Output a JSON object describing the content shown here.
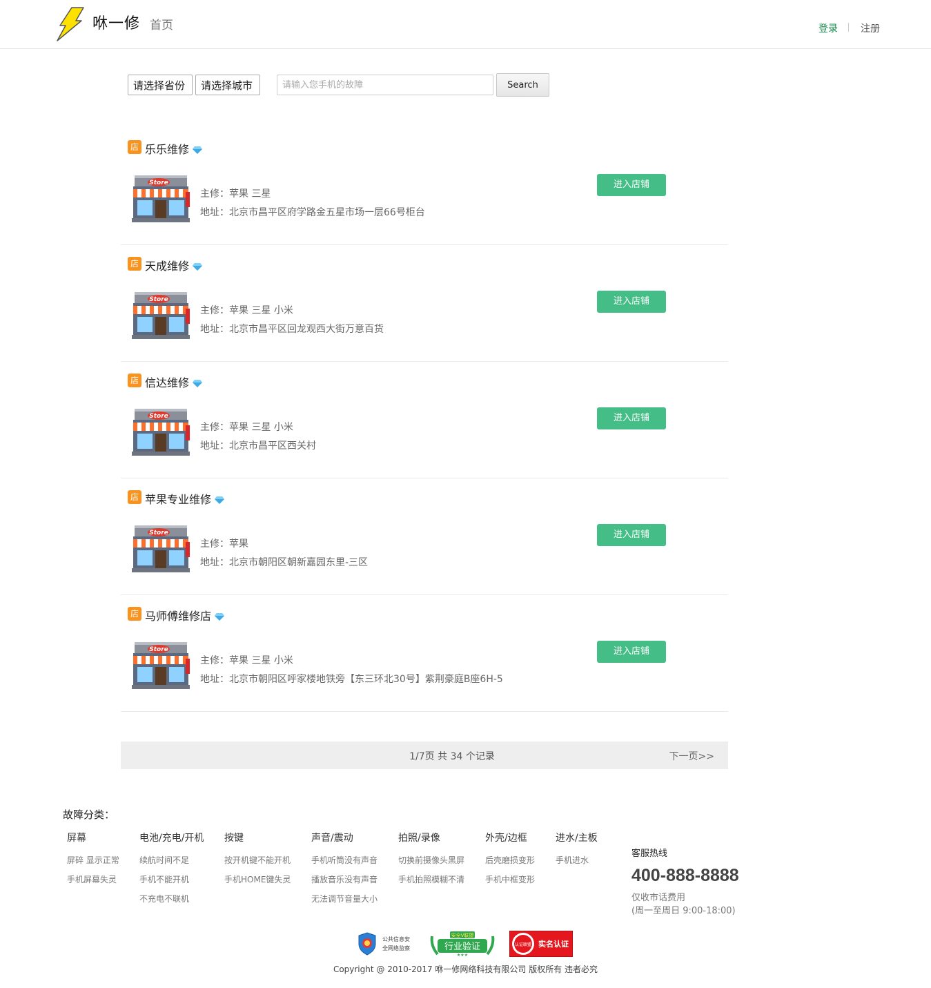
{
  "header": {
    "brand": "咻一修",
    "home": "首页",
    "login": "登录",
    "register": "注册"
  },
  "search": {
    "province": "请选择省份",
    "city": "请选择城市",
    "placeholder": "请输入您手机的故障",
    "button": "Search"
  },
  "shops": [
    {
      "badge": "店",
      "name": "乐乐维修",
      "brands": "主修：苹果 三星",
      "address": "地址：北京市昌平区府学路金五星市场一层66号柜台",
      "button": "进入店铺"
    },
    {
      "badge": "店",
      "name": "天成维修",
      "brands": "主修：苹果 三星 小米",
      "address": "地址：北京市昌平区回龙观西大街万意百货",
      "button": "进入店铺"
    },
    {
      "badge": "店",
      "name": "信达维修",
      "brands": "主修：苹果 三星 小米",
      "address": "地址：北京市昌平区西关村",
      "button": "进入店铺"
    },
    {
      "badge": "店",
      "name": "苹果专业维修",
      "brands": "主修：苹果",
      "address": "地址：北京市朝阳区朝新嘉园东里-三区",
      "button": "进入店铺"
    },
    {
      "badge": "店",
      "name": "马师傅维修店",
      "brands": "主修：苹果 三星 小米",
      "address": "地址：北京市朝阳区呼家楼地铁旁【东三环北30号】紫荆豪庭B座6H-5",
      "button": "进入店铺"
    }
  ],
  "pager": {
    "info": "1/7页 共 34 个记录",
    "next": "下一页>>"
  },
  "footer": {
    "category_title": "故障分类：",
    "categories": [
      {
        "head": "屏幕",
        "items": [
          "屏碎 显示正常",
          "手机屏幕失灵"
        ]
      },
      {
        "head": "电池/充电/开机",
        "items": [
          "续航时间不足",
          "手机不能开机",
          "不充电不联机"
        ]
      },
      {
        "head": "按键",
        "items": [
          "按开机键不能开机",
          "手机HOME键失灵"
        ]
      },
      {
        "head": "声音/震动",
        "items": [
          "手机听筒没有声音",
          "播放音乐没有声音",
          "无法调节音量大小"
        ]
      },
      {
        "head": "拍照/录像",
        "items": [
          "切换前摄像头黑屏",
          "手机拍照模糊不清"
        ]
      },
      {
        "head": "外壳/边框",
        "items": [
          "后壳磨损变形",
          "手机中框变形"
        ]
      },
      {
        "head": "进水/主板",
        "items": [
          "手机进水"
        ]
      }
    ],
    "hotline_label": "客服热线",
    "hotline_number": "400-888-8888",
    "hotline_note1": "仅收市话费用",
    "hotline_note2": "(周一至周日 9:00-18:00)",
    "cert1_text1": "公共信息安",
    "cert1_text2": "全网络监察",
    "cert2_text_top": "安全V联盟",
    "cert2_text": "行业验证",
    "cert3_text_left": "认证联盟",
    "cert3_text": "实名认证",
    "copyright": "Copyright @ 2010-2017 咻一修网络科技有限公司 版权所有 违者必究"
  },
  "colors": {
    "accent_green": "#44bd87",
    "login_green": "#1a8f4d",
    "badge_orange": "#f7931e"
  }
}
